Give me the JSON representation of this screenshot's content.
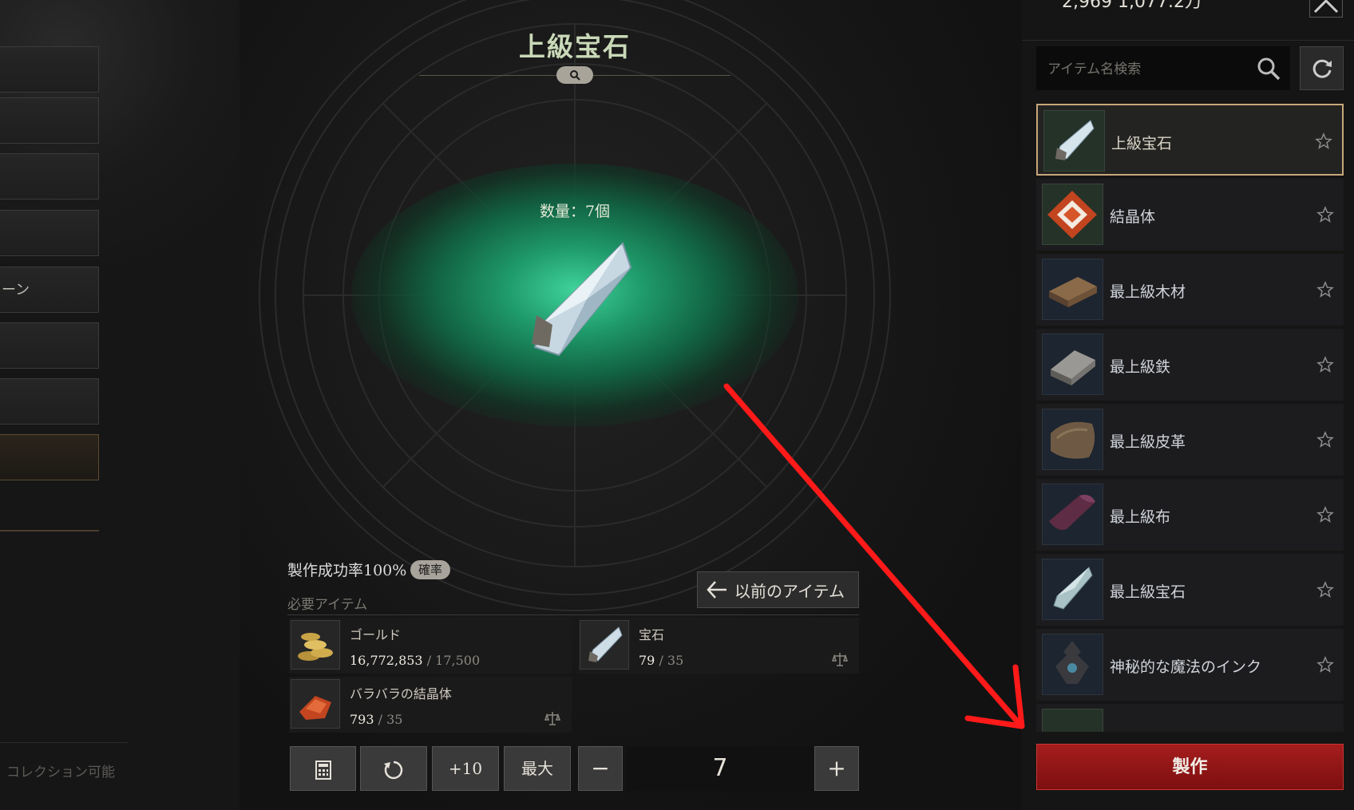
{
  "left_menu": {
    "items": [
      {
        "label": ""
      },
      {
        "label": ""
      },
      {
        "label": ""
      },
      {
        "label": ""
      },
      {
        "label": "ーン"
      },
      {
        "label": ""
      },
      {
        "label": ""
      },
      {
        "label": ""
      }
    ],
    "bottom_label": "コレクション可能"
  },
  "center": {
    "title": "上級宝石",
    "quantity_label": "数量：7個",
    "success_rate": "製作成功率100%",
    "probability_badge": "確率",
    "required_label": "必要アイテム",
    "previous_item_button": "以前のアイテム",
    "materials": [
      {
        "name": "ゴールド",
        "owned": "16,772,853",
        "required": "/ 17,500",
        "icon": "gold-coins-icon"
      },
      {
        "name": "宝石",
        "owned": "79",
        "required": "/ 35",
        "icon": "gem-icon"
      },
      {
        "name": "バラバラの結晶体",
        "owned": "793",
        "required": "/ 35",
        "icon": "crystal-shards-icon"
      }
    ],
    "controls": {
      "calc_icon": "calculator-icon",
      "reset_icon": "reset-icon",
      "plus10": "+10",
      "max": "最大",
      "minus": "−",
      "quantity": "7",
      "plus": "+"
    }
  },
  "right": {
    "currency": "2,969   1,077.2万",
    "search_placeholder": "アイテム名検索",
    "items": [
      {
        "label": "上級宝石",
        "selected": true,
        "icon": "gem-icon"
      },
      {
        "label": "結晶体",
        "icon": "crystal-icon"
      },
      {
        "label": "最上級木材",
        "icon": "wood-icon"
      },
      {
        "label": "最上級鉄",
        "icon": "iron-icon"
      },
      {
        "label": "最上級皮革",
        "icon": "leather-icon"
      },
      {
        "label": "最上級布",
        "icon": "cloth-icon"
      },
      {
        "label": "最上級宝石",
        "icon": "gem-icon"
      },
      {
        "label": "神秘的な魔法のインク",
        "icon": "ink-icon"
      }
    ],
    "craft_button": "製作"
  },
  "colors": {
    "accent_gold": "#c8a77a",
    "craft_red": "#a51d1d",
    "glow_green": "#3fd39a",
    "annotation_arrow": "#ff1a1a"
  }
}
